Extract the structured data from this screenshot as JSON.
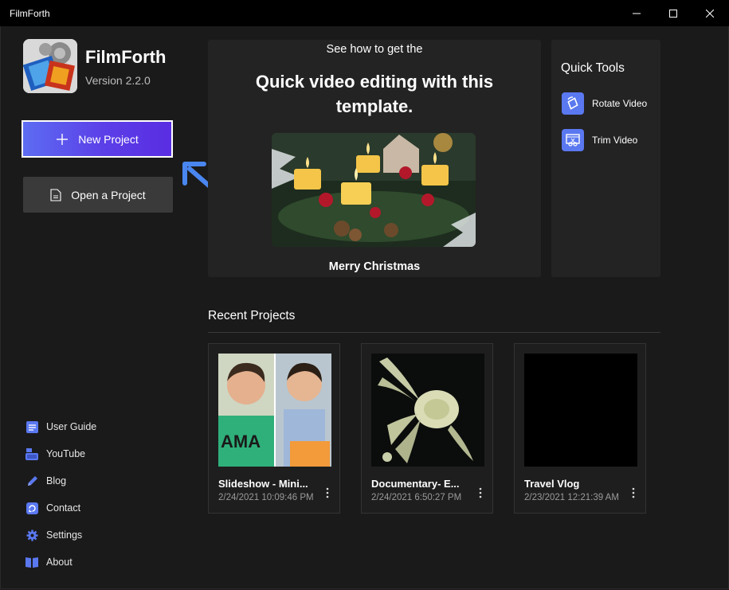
{
  "window": {
    "title": "FilmForth"
  },
  "app": {
    "name": "FilmForth",
    "version": "Version 2.2.0"
  },
  "actions": {
    "new_project": "New Project",
    "open_project": "Open a Project"
  },
  "sidebar": {
    "links": [
      {
        "label": "User Guide",
        "icon": "user-guide-icon"
      },
      {
        "label": "YouTube",
        "icon": "youtube-icon"
      },
      {
        "label": "Blog",
        "icon": "pencil-icon"
      },
      {
        "label": "Contact",
        "icon": "contact-icon"
      },
      {
        "label": "Settings",
        "icon": "gear-icon"
      },
      {
        "label": "About",
        "icon": "book-icon"
      }
    ]
  },
  "promo": {
    "subtitle": "See how to get the",
    "heading": "Quick video editing with this template.",
    "caption": "Merry Christmas"
  },
  "quick_tools": {
    "title": "Quick Tools",
    "items": [
      {
        "label": "Rotate Video",
        "icon": "rotate-video-icon"
      },
      {
        "label": "Trim Video",
        "icon": "trim-video-icon"
      }
    ]
  },
  "recent": {
    "title": "Recent Projects",
    "projects": [
      {
        "name": "Slideshow - Mini...",
        "date": "2/24/2021 10:09:46 PM"
      },
      {
        "name": "Documentary- E...",
        "date": "2/24/2021 6:50:27 PM"
      },
      {
        "name": "Travel Vlog",
        "date": "2/23/2021 12:21:39 AM"
      }
    ]
  },
  "colors": {
    "accent": "#5a78f0",
    "new_project_gradient_start": "#5d6cf2",
    "new_project_gradient_end": "#5a2de2",
    "background": "#1a1a1a",
    "panel": "#232323"
  }
}
